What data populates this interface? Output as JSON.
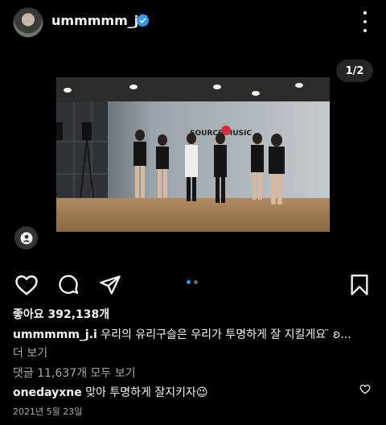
{
  "header": {
    "username": "ummmmm_j.i",
    "verified_icon": "verified-badge-icon",
    "more_icon": "more-options-icon"
  },
  "media": {
    "page_counter": "1/2",
    "studio_sign": "SOURCE MUSIC"
  },
  "actions": {
    "like_icon": "heart-icon",
    "comment_icon": "comment-icon",
    "share_icon": "send-icon",
    "save_icon": "bookmark-icon",
    "carousel_total": 2,
    "carousel_active": 1,
    "accent_color": "#3897f0"
  },
  "post": {
    "likes": "좋아요 392,138개",
    "caption_user": "ummmmm_j.i",
    "caption_text": "우리의 유리구슬은 우리가 투명하게 잘 지킬게요 ̈ ʚ...",
    "more_label": "더 보기",
    "view_comments": "댓글 11,637개 모두 보기",
    "comment_user": "onedayxne",
    "comment_text": "맞아 투명하게 잘지키자😉",
    "date": "2021년 5월 23일"
  }
}
